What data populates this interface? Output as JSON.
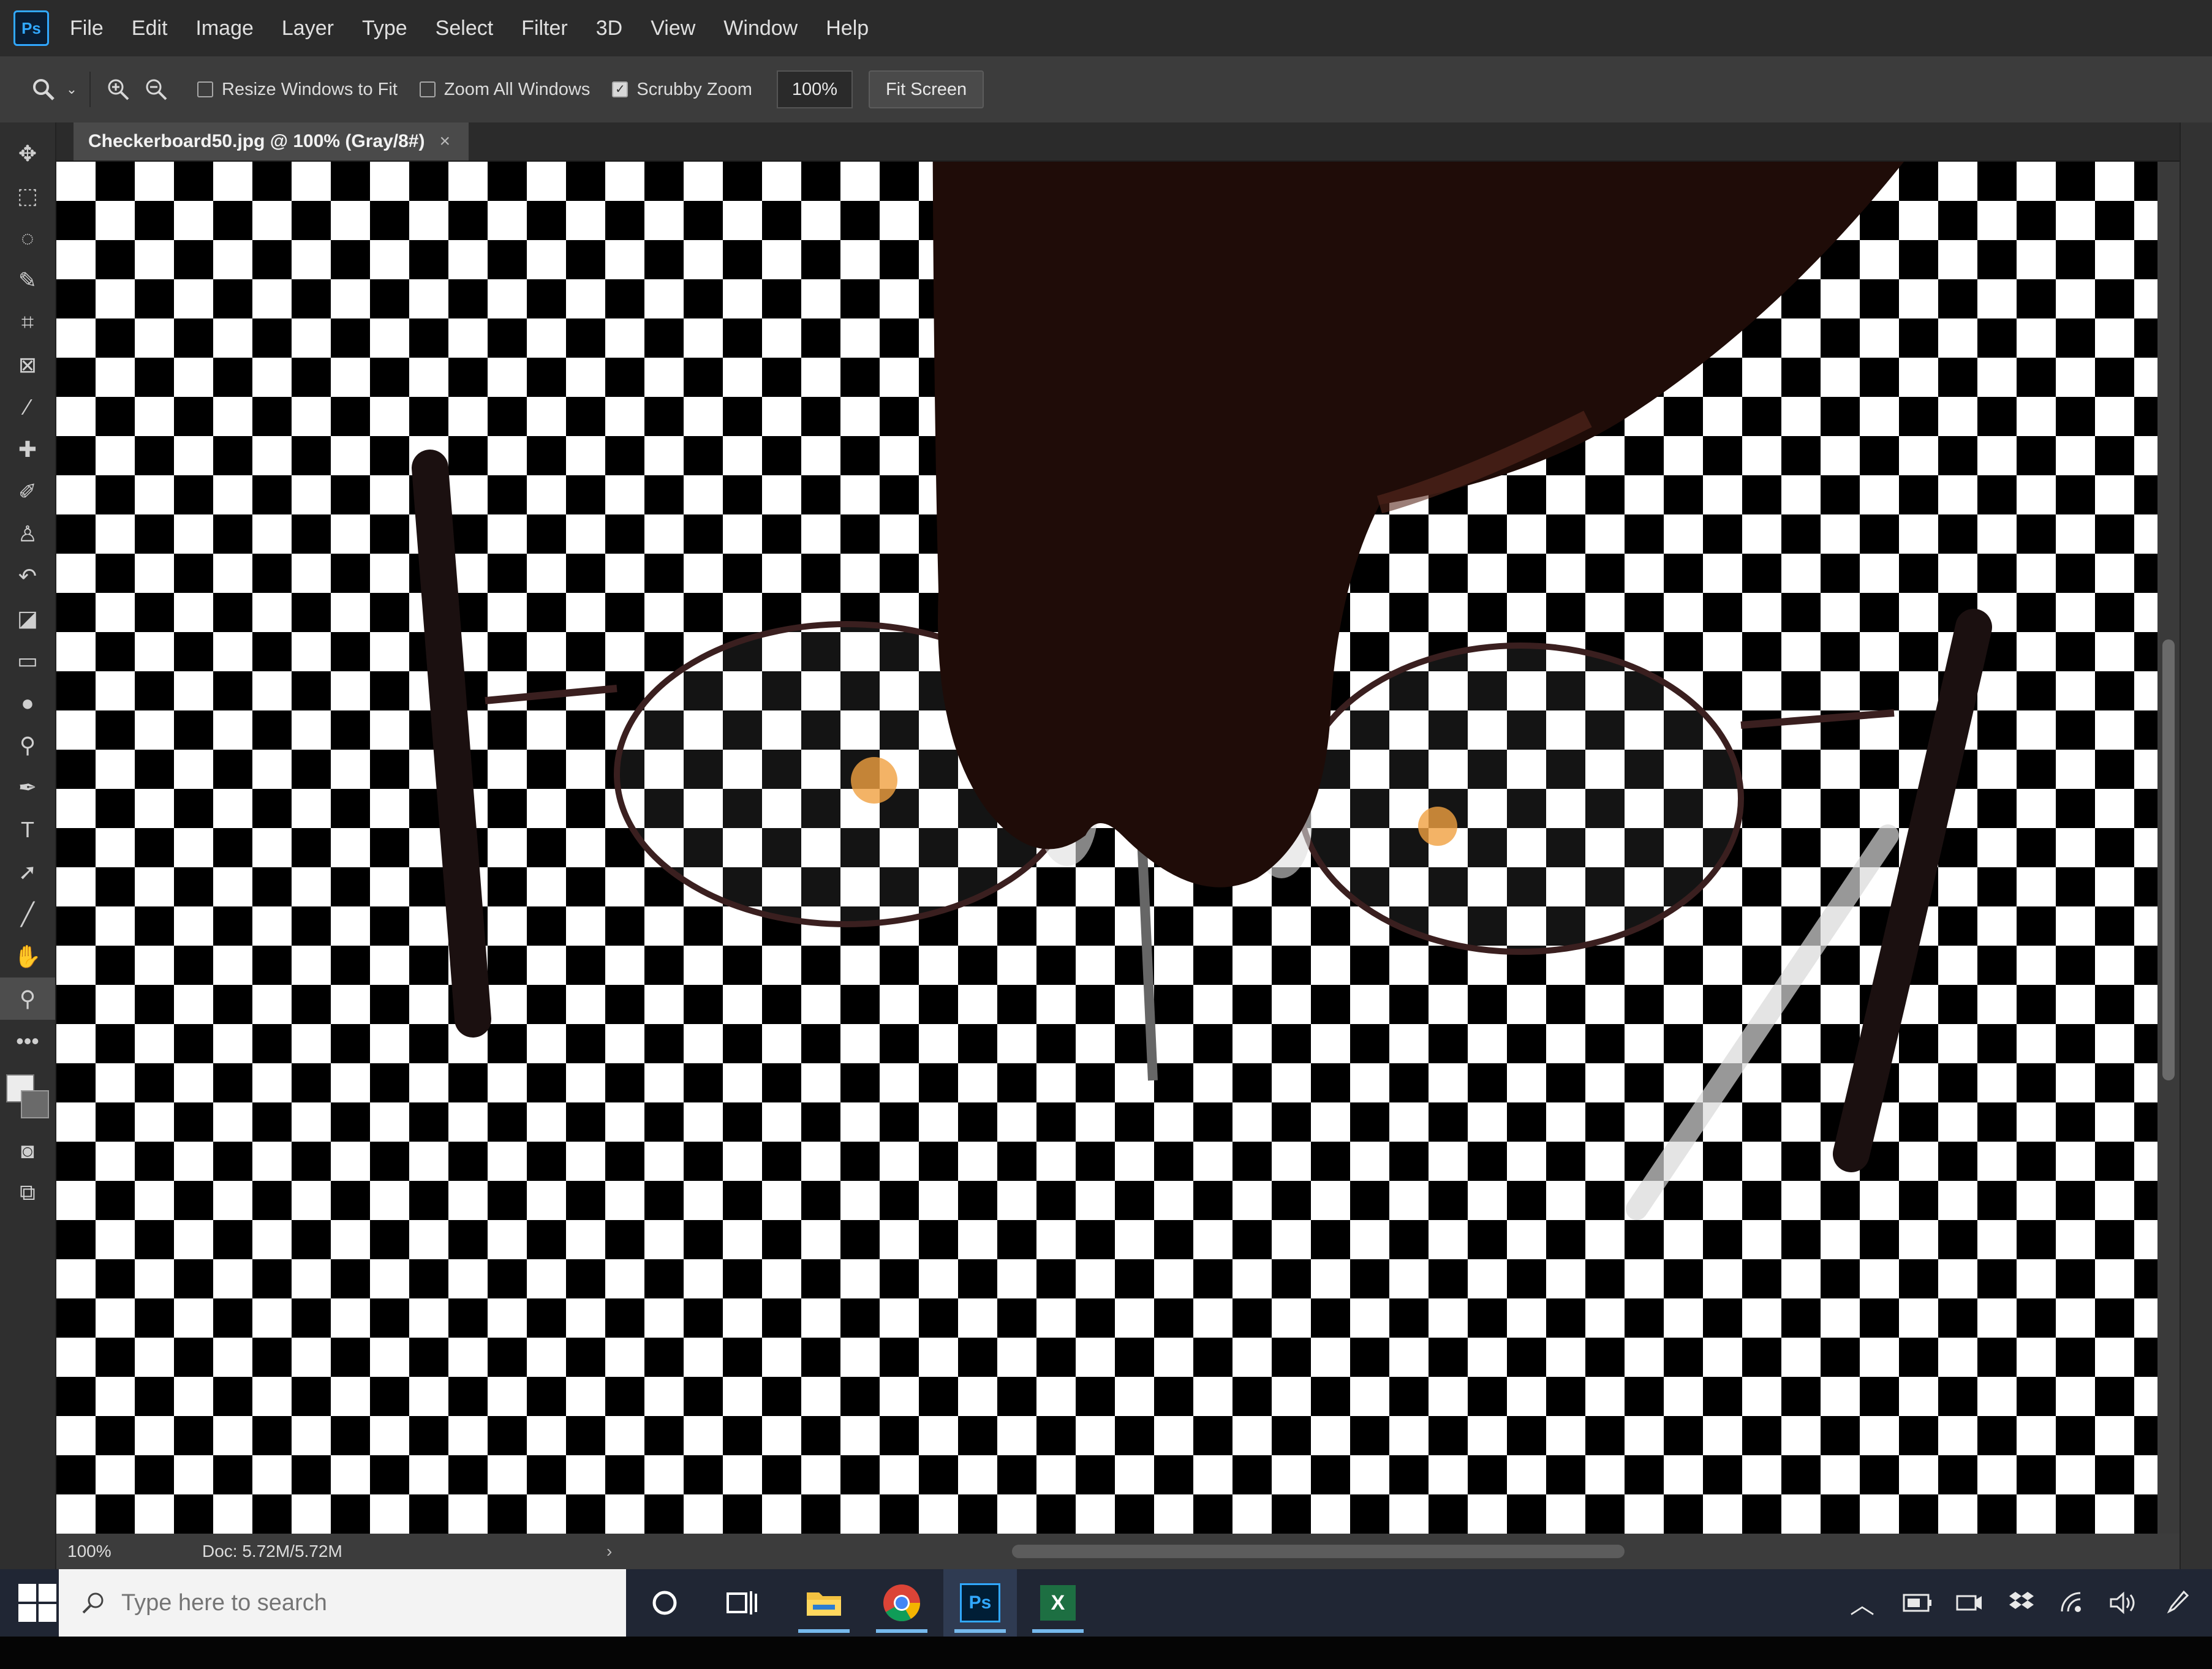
{
  "app": {
    "logo": "Ps",
    "menu": [
      "File",
      "Edit",
      "Image",
      "Layer",
      "Type",
      "Select",
      "Filter",
      "3D",
      "View",
      "Window",
      "Help"
    ]
  },
  "options": {
    "resize_windows": {
      "label": "Resize Windows to Fit",
      "checked": false
    },
    "zoom_all_windows": {
      "label": "Zoom All Windows",
      "checked": false
    },
    "scrubby_zoom": {
      "label": "Scrubby Zoom",
      "checked": true
    },
    "zoom_value": "100%",
    "fit_screen_label": "Fit Screen"
  },
  "tools": [
    {
      "name": "move-tool-icon",
      "glyph": "✥"
    },
    {
      "name": "marquee-tool-icon",
      "glyph": "⬚"
    },
    {
      "name": "lasso-tool-icon",
      "glyph": "◌"
    },
    {
      "name": "quick-select-tool-icon",
      "glyph": "✎"
    },
    {
      "name": "crop-tool-icon",
      "glyph": "⌗"
    },
    {
      "name": "frame-tool-icon",
      "glyph": "⊠"
    },
    {
      "name": "eyedropper-tool-icon",
      "glyph": "⁄"
    },
    {
      "name": "healing-brush-tool-icon",
      "glyph": "✚"
    },
    {
      "name": "brush-tool-icon",
      "glyph": "✐"
    },
    {
      "name": "clone-stamp-tool-icon",
      "glyph": "♙"
    },
    {
      "name": "history-brush-tool-icon",
      "glyph": "↶"
    },
    {
      "name": "eraser-tool-icon",
      "glyph": "◪"
    },
    {
      "name": "gradient-tool-icon",
      "glyph": "▭"
    },
    {
      "name": "blur-tool-icon",
      "glyph": "●"
    },
    {
      "name": "dodge-tool-icon",
      "glyph": "⚲"
    },
    {
      "name": "pen-tool-icon",
      "glyph": "✒"
    },
    {
      "name": "type-tool-icon",
      "glyph": "T"
    },
    {
      "name": "path-select-tool-icon",
      "glyph": "➚"
    },
    {
      "name": "line-tool-icon",
      "glyph": "╱"
    },
    {
      "name": "hand-tool-icon",
      "glyph": "✋"
    },
    {
      "name": "zoom-tool-icon",
      "glyph": "⚲"
    },
    {
      "name": "more-tools-icon",
      "glyph": "•••"
    }
  ],
  "document": {
    "tab_title": "Checkerboard50.jpg @ 100% (Gray/8#)",
    "close_glyph": "×"
  },
  "status": {
    "zoom": "100%",
    "doc": "Doc: 5.72M/5.72M",
    "arrow": "›"
  },
  "taskbar": {
    "search_placeholder": "Type here to search",
    "apps": [
      "cortana-icon",
      "task-view-icon",
      "file-explorer-icon",
      "chrome-icon",
      "photoshop-taskbar-icon",
      "excel-taskbar-icon"
    ],
    "ps_label": "Ps",
    "excel_label": "X"
  },
  "colors": {
    "foreground": "#ececec",
    "background": "#6a6a6a",
    "taskbar_active": "#76b9ed"
  }
}
